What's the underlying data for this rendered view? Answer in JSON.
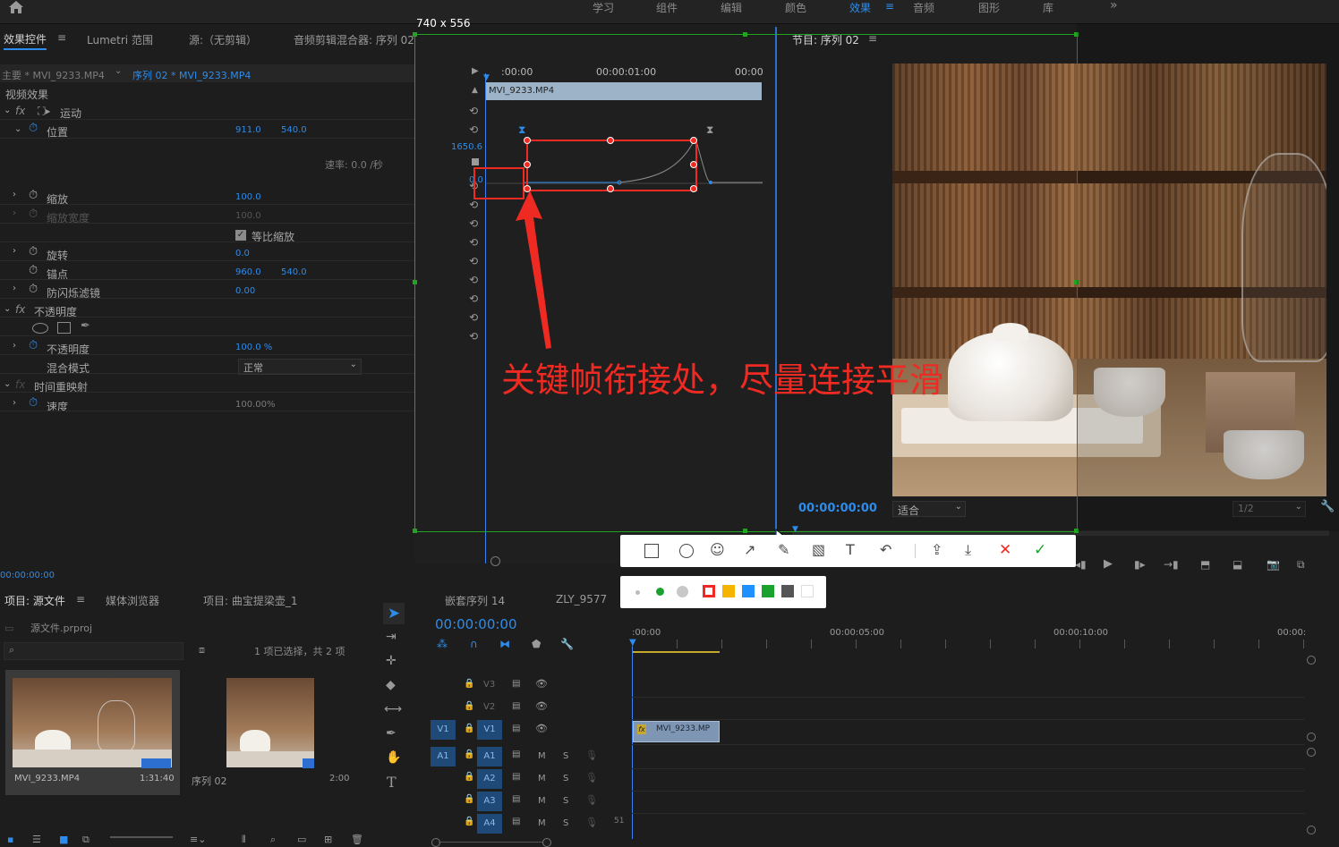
{
  "workspace_tabs": [
    "学习",
    "组件",
    "编辑",
    "颜色",
    "效果",
    "音频",
    "图形",
    "库"
  ],
  "workspace_active_index": 4,
  "capture_size_label": "740 x 556",
  "effect_controls": {
    "tabs": [
      "效果控件",
      "Lumetri 范围",
      "源:（无剪辑）",
      "音频剪辑混合器: 序列 02"
    ],
    "clip_path_main": "主要 * MVI_9233.MP4",
    "clip_path_seq": "序列 02 * MVI_9233.MP4",
    "section_video_effects": "视频效果",
    "motion_label": "运动",
    "rows": {
      "position": {
        "label": "位置",
        "x": "911.0",
        "y": "540.0"
      },
      "velocity": "速率: 0.0 /秒",
      "scale": {
        "label": "缩放",
        "value": "100.0"
      },
      "scale_width": {
        "label": "缩放宽度",
        "value": "100.0"
      },
      "uniform_scale": "等比缩放",
      "rotation": {
        "label": "旋转",
        "value": "0.0"
      },
      "anchor": {
        "label": "锚点",
        "x": "960.0",
        "y": "540.0"
      },
      "flicker": {
        "label": "防闪烁滤镜",
        "value": "0.00"
      },
      "opacity_section": "不透明度",
      "opacity": {
        "label": "不透明度",
        "value": "100.0 %"
      },
      "blend_mode": {
        "label": "混合模式",
        "value": "正常"
      },
      "time_remap": "时间重映射",
      "speed": {
        "label": "速度",
        "value": "100.00%"
      }
    },
    "timecode": "00:00:00:00"
  },
  "ec_timeline": {
    "ruler": [
      ":00:00",
      "00:00:01:00",
      "00:00"
    ],
    "clip_name": "MVI_9233.MP4",
    "graph_max": "1650.6",
    "graph_zero": "0.0"
  },
  "annotation_text": "关键帧衔接处，尽量连接平滑",
  "program": {
    "title": "节目: 序列 02",
    "timecode": "00:00:00:00",
    "fit": "适合",
    "resolution": "1/2"
  },
  "project": {
    "tabs": [
      "项目: 源文件",
      "媒体浏览器",
      "项目: 曲宝提梁壶_1"
    ],
    "file": "源文件.prproj",
    "search_placeholder": "",
    "selection_info": "1 项已选择，共 2 项",
    "items": [
      {
        "name": "MVI_9233.MP4",
        "duration": "1:31:40"
      },
      {
        "name": "序列 02",
        "duration": "2:00"
      }
    ]
  },
  "timeline": {
    "tabs": [
      "嵌套序列 14",
      "ZLY_9577"
    ],
    "timecode": "00:00:00:00",
    "ruler": [
      ":00:00",
      "00:00:05:00",
      "00:00:10:00",
      "00:00:"
    ],
    "video_tracks": [
      "V3",
      "V2",
      "V1"
    ],
    "audio_tracks": [
      "A1",
      "A2",
      "A3",
      "A4"
    ],
    "src_v": "V1",
    "src_a": "A1",
    "clip_label": "MVI_9233.MP",
    "audio_m": "M",
    "audio_s": "S",
    "meter_value": "51"
  },
  "screenshot_tool": {
    "colors": [
      "#ef2a22",
      "#f5b400",
      "#1e90ff",
      "#1aa32c",
      "#555555",
      "#ffffff"
    ],
    "selected_color": "#ef2a22"
  }
}
